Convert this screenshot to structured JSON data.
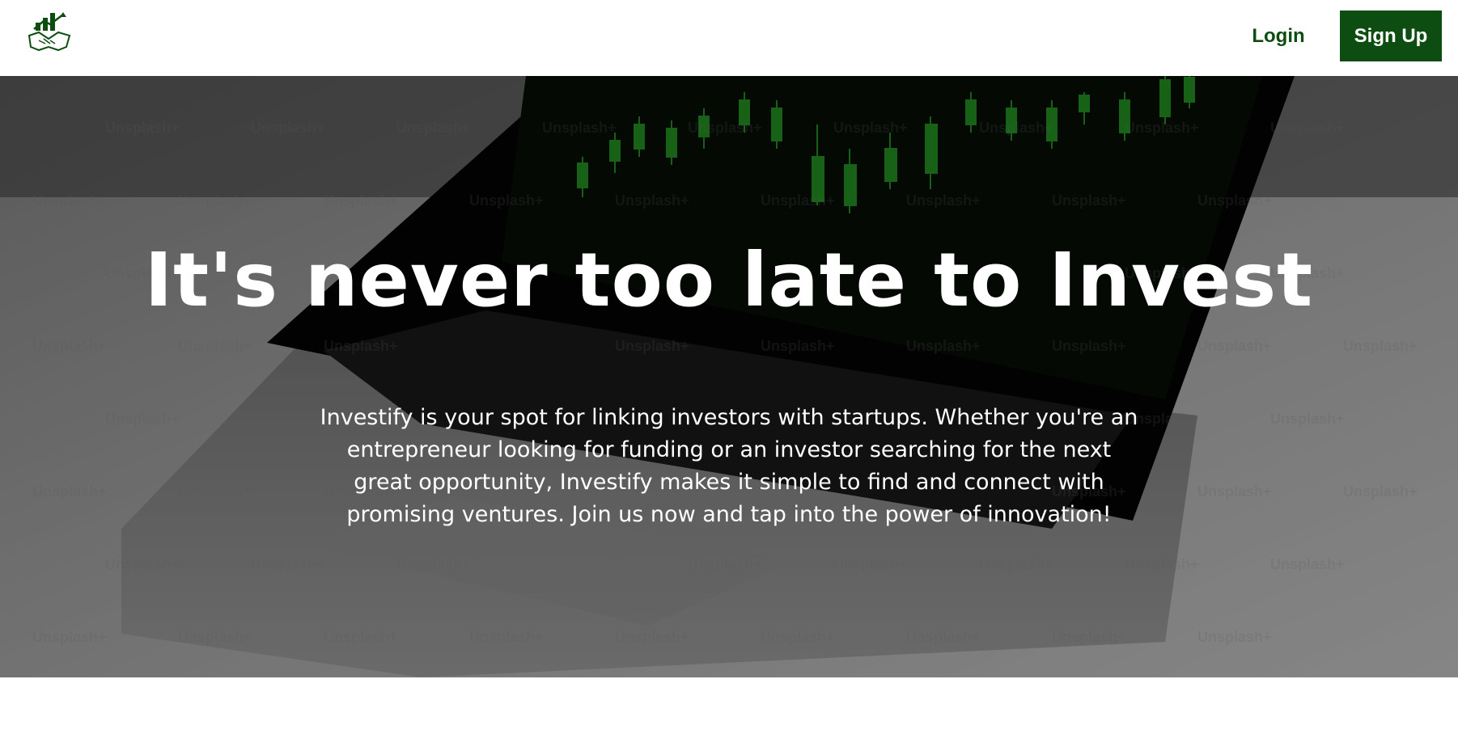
{
  "header": {
    "logo_icon": "investing-handshake-chart-icon",
    "login_label": "Login",
    "signup_label": "Sign Up"
  },
  "hero": {
    "title": "It's never too late to Invest",
    "description": "Investify is your spot for linking investors with startups. Whether you're an entrepreneur looking for funding or an investor searching for the next great opportunity, Investify makes it simple to find and connect with promising ventures. Join us now and tap into the power of innovation!",
    "background_image": "laptop-stock-chart-photo",
    "watermark": "Unsplash+"
  },
  "colors": {
    "brand_green": "#0e4d12",
    "chart_green": "#2ec52e",
    "text_white": "#ffffff"
  }
}
